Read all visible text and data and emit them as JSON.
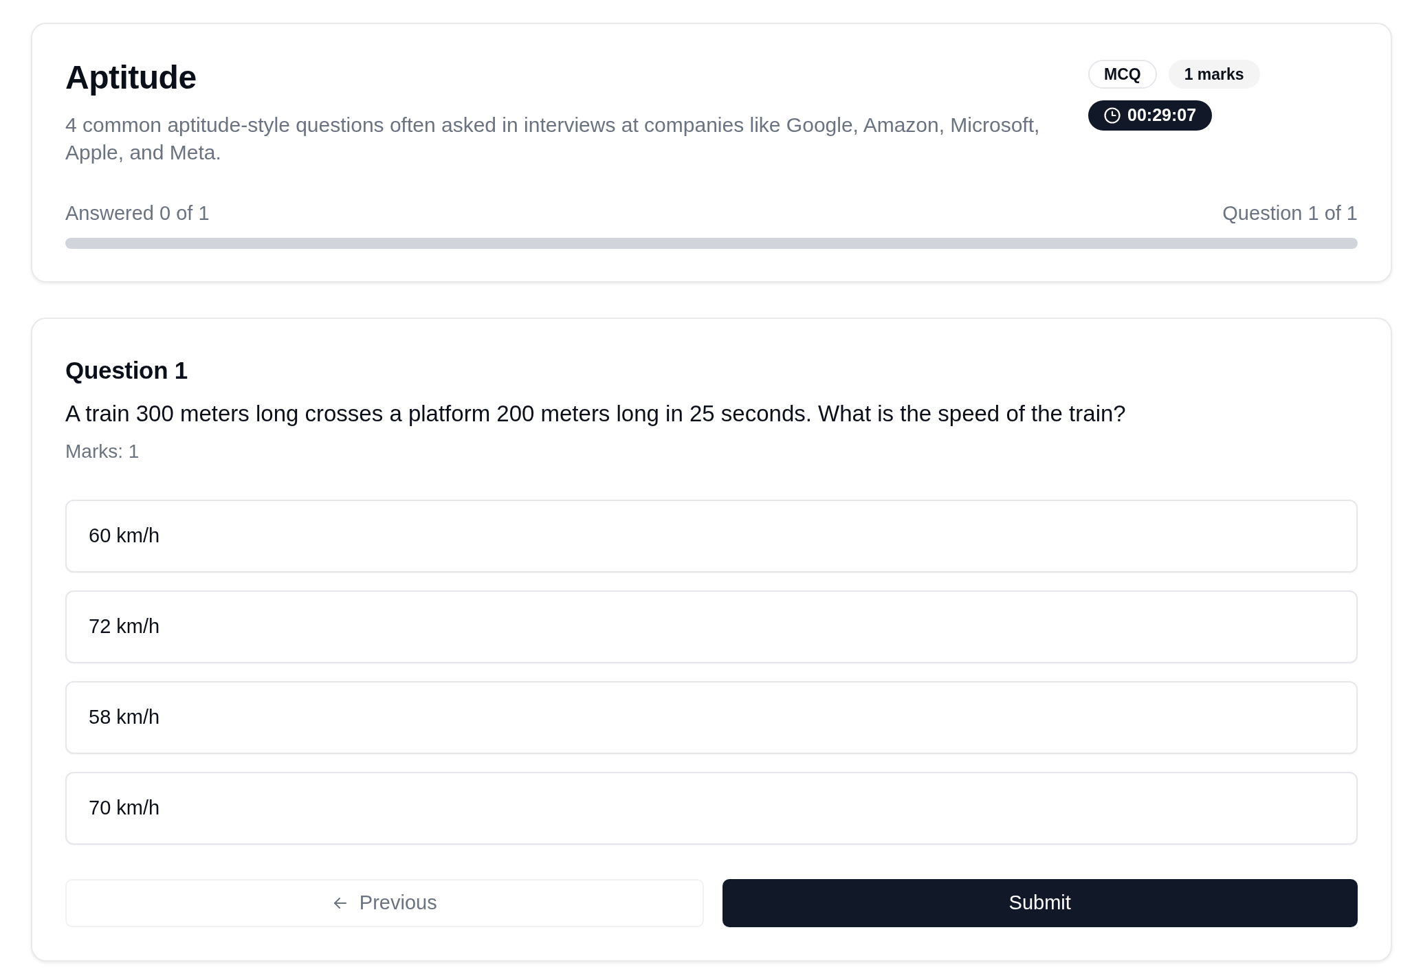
{
  "header": {
    "title": "Aptitude",
    "description": "4 common aptitude-style questions often asked in interviews at companies like Google, Amazon, Microsoft, Apple, and Meta.",
    "badges": [
      {
        "kind": "outline",
        "text": "MCQ"
      },
      {
        "kind": "muted",
        "text": "1 marks"
      }
    ],
    "timer": "00:29:07"
  },
  "progress": {
    "answered": "Answered 0 of 1",
    "position": "Question 1 of 1",
    "level": 0
  },
  "question": {
    "heading": "Question 1",
    "text": "A train 300 meters long crosses a platform 200 meters long in 25 seconds. What is the speed of the train?",
    "marks": "Marks: 1",
    "options": [
      {
        "label": "60 km/h",
        "selected": false
      },
      {
        "label": "72 km/h",
        "selected": false
      },
      {
        "label": "58 km/h",
        "selected": false
      },
      {
        "label": "70 km/h",
        "selected": false
      }
    ]
  },
  "navigation": {
    "previous": {
      "label": "Previous",
      "disabled": true
    },
    "submit": {
      "label": "Submit"
    }
  }
}
